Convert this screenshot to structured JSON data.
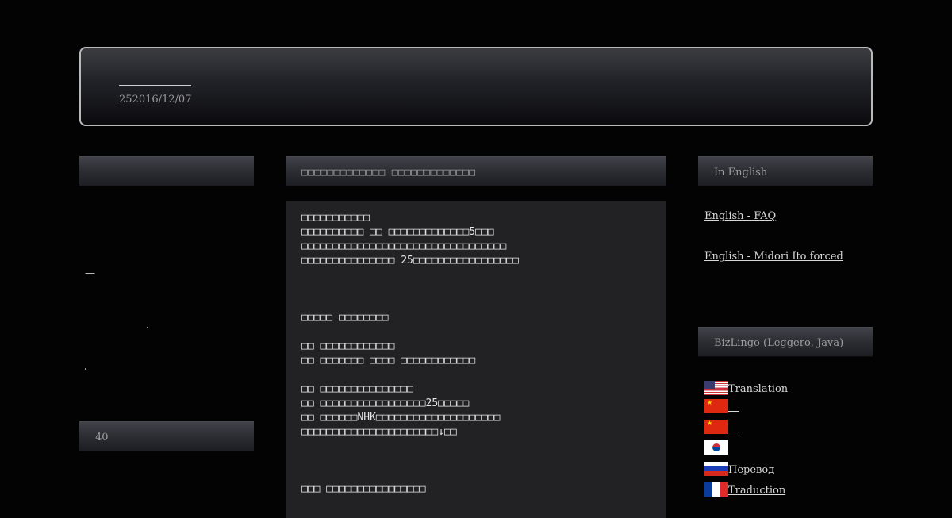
{
  "header": {
    "date": "252016/12/07"
  },
  "left": {
    "dash": "—",
    "count_title": "40"
  },
  "post": {
    "title": "□□□□□□□□□□□□□ □□□□□□□□□□□□□",
    "lines": [
      "□□□□□□□□□□□",
      "□□□□□□□□□□ □□ □□□□□□□□□□□□□5□□□",
      "□□□□□□□□□□□□□□□□□□□□□□□□□□□□□□□□□",
      "□□□□□□□□□□□□□□□ 25□□□□□□□□□□□□□□□□□",
      "□□□□□ □□□□□□□□",
      "□□ □□□□□□□□□□□□",
      "□□ □□□□□□□ □□□□ □□□□□□□□□□□□",
      "□□ □□□□□□□□□□□□□□□",
      "□□ □□□□□□□□□□□□□□□□□25□□□□□",
      "□□ □□□□□□NHK□□□□□□□□□□□□□□□□□□□□",
      "□□□□□□□□□□□□□□□□□□□□□□↓□□",
      "□□□ □□□□□□□□□□□□□□□□"
    ]
  },
  "right": {
    "section1_title": "In English",
    "links": [
      "English - FAQ",
      "English - Midori Ito forced"
    ],
    "section2_title": "BizLingo (Leggero, Java)",
    "languages": [
      {
        "flag": "us-flag-icon",
        "label": "Translation"
      },
      {
        "flag": "china-flag-icon",
        "label": "＿"
      },
      {
        "flag": "china-flag-icon",
        "label": "＿"
      },
      {
        "flag": "korea-flag-icon",
        "label": ""
      },
      {
        "flag": "russia-flag-icon",
        "label": "Перевод"
      },
      {
        "flag": "france-flag-icon",
        "label": "Traduction"
      }
    ]
  }
}
